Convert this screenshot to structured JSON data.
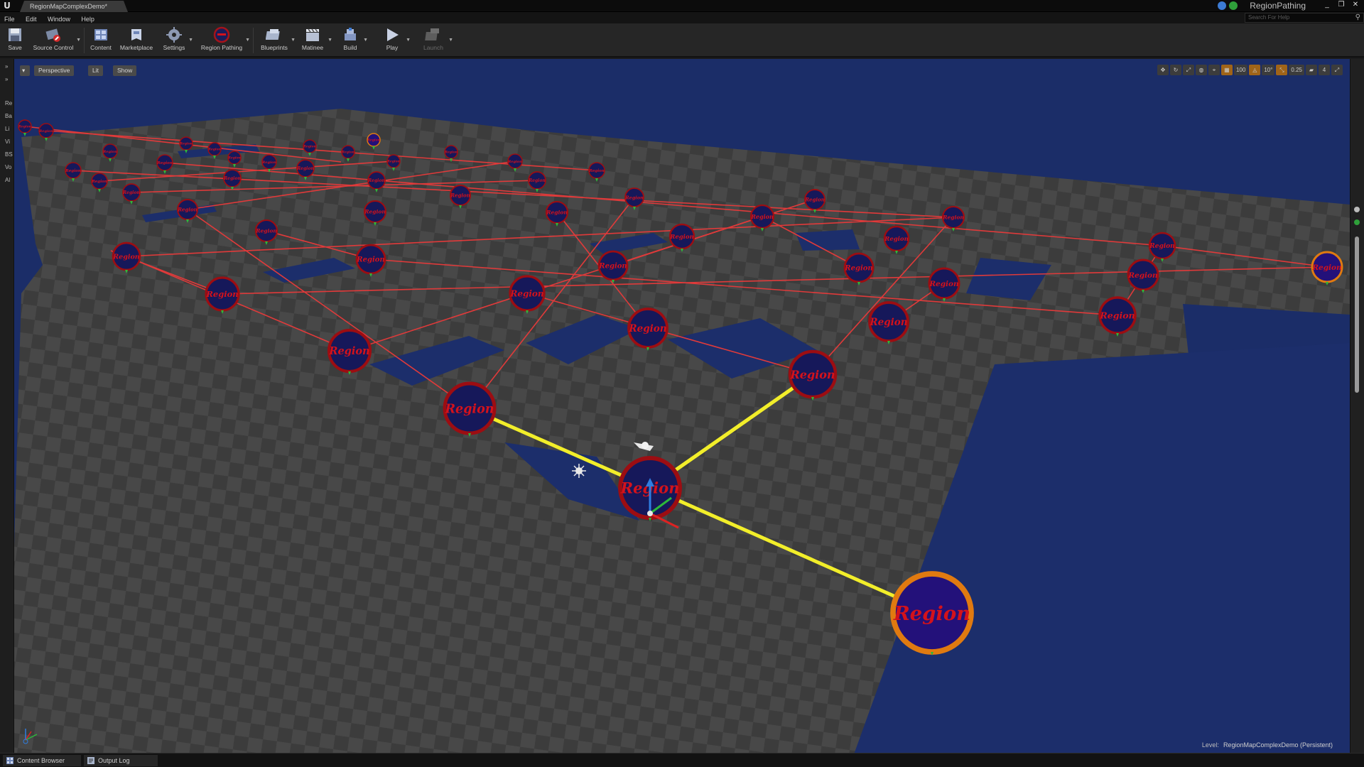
{
  "window": {
    "tab_title": "RegionMapComplexDemo*",
    "project_name": "RegionPathing",
    "controls": [
      "_",
      "❐",
      "✕"
    ]
  },
  "menu": [
    "File",
    "Edit",
    "Window",
    "Help"
  ],
  "help_search": {
    "placeholder": "Search For Help"
  },
  "toolbar": {
    "save": "Save",
    "source_control": "Source Control",
    "content": "Content",
    "marketplace": "Marketplace",
    "settings": "Settings",
    "region_pathing": "Region Pathing",
    "blueprints": "Blueprints",
    "matinee": "Matinee",
    "build": "Build",
    "play": "Play",
    "launch": "Launch"
  },
  "left_tabs": [
    "Re",
    "Ba",
    "Li",
    "Vi",
    "BS",
    "Vo",
    "Al"
  ],
  "viewport": {
    "perspective": "Perspective",
    "lit": "Lit",
    "show": "Show",
    "grid_snap": "100",
    "rotation_snap": "10°",
    "scale_snap": "0.25",
    "camera_speed": "4",
    "level_label": "Level:",
    "level_name": "RegionMapComplexDemo (Persistent)"
  },
  "region_label": "Region",
  "bottom_tabs": [
    "Content Browser",
    "Output Log"
  ],
  "colors": {
    "path_highlight": "#f2ee2a",
    "connection": "#e03a3a",
    "region_fill": "#16185a",
    "region_ring": "#9c0d12",
    "selected_ring": "#e07a10",
    "floor": "#3c3c3c",
    "background": "#1b2d68"
  }
}
